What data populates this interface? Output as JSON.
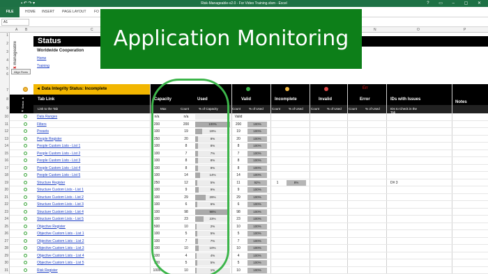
{
  "window": {
    "title": "Risk-Manageable-v2.0 - For Video Training.xlsm - Excel"
  },
  "ribbon": {
    "file": "FILE",
    "tabs": [
      "HOME",
      "INSERT",
      "PAGE LAYOUT",
      "FO"
    ]
  },
  "namebox": "A1",
  "columns": [
    "A",
    "B",
    "C",
    "D",
    "E",
    "F",
    "G",
    "H",
    "I",
    "J",
    "K",
    "L",
    "M",
    "N",
    "O",
    "P"
  ],
  "sheet": {
    "status_title": "Status",
    "company": "Worldwide Cooperation",
    "home_link": "Home",
    "training_link": "Training",
    "align_button": "Align Rows",
    "logo_risk": "risk",
    "logo_manageable": "manageable"
  },
  "banner": {
    "text": "Application Monitoring",
    "color": "#0d7f19"
  },
  "table": {
    "status_heading": "◄ Data Integrity Status: Incomplete",
    "status_side_label": "◄ Status ►",
    "headers": {
      "tab_link": "Tab Link",
      "capacity": "Capacity",
      "used": "Used",
      "valid": "Valid",
      "incomplete": "Incomplete",
      "invalid": "Invalid",
      "error": "Error",
      "ids_with_issues": "IDs with Issues",
      "notes": "Notes",
      "error_flag": "Err"
    },
    "subheaders": {
      "link_to_tab": "Link to the Tab",
      "max": "Max",
      "count": "Count",
      "pct_capacity": "% of Capacity",
      "count_valid": "Count",
      "pct_used_valid": "% of Used",
      "count_incomplete": "Count",
      "pct_used_incomplete": "% of Used",
      "count_invalid": "Count",
      "pct_used_invalid": "% of Used",
      "count_error": "Count",
      "pct_used_error": "% of Used",
      "ids_to_check": "IDs to Check in the Tab"
    },
    "row_numbers": [
      "1",
      "2",
      "3",
      "4",
      "5",
      "6",
      "7",
      "8",
      "9",
      "10",
      "11",
      "12",
      "13",
      "14",
      "15",
      "16",
      "17",
      "18",
      "19",
      "20",
      "21",
      "22",
      "23",
      "24",
      "25",
      "26",
      "27",
      "28",
      "29",
      "30",
      "31"
    ],
    "rows": [
      {
        "name": "Data Ranges",
        "max": "n/a",
        "count": "n/a",
        "pct": "",
        "pct_fill": 0,
        "valid": "Valid",
        "valid_pct": "",
        "incomplete": "",
        "incomplete_pct": "",
        "ids": ""
      },
      {
        "name": "Filters",
        "max": "200",
        "count": "200",
        "pct": "100%",
        "pct_fill": 1.0,
        "valid": "200",
        "valid_pct": "100%",
        "incomplete": "",
        "incomplete_pct": "",
        "ids": ""
      },
      {
        "name": "Presets",
        "max": "100",
        "count": "19",
        "pct": "19%",
        "pct_fill": 0.19,
        "valid": "19",
        "valid_pct": "100%",
        "incomplete": "",
        "incomplete_pct": "",
        "ids": ""
      },
      {
        "name": "People Register",
        "max": "250",
        "count": "20",
        "pct": "8%",
        "pct_fill": 0.08,
        "valid": "20",
        "valid_pct": "100%",
        "incomplete": "",
        "incomplete_pct": "",
        "ids": ""
      },
      {
        "name": "People Custom Lists - List 1",
        "max": "100",
        "count": "8",
        "pct": "8%",
        "pct_fill": 0.08,
        "valid": "8",
        "valid_pct": "100%",
        "incomplete": "",
        "incomplete_pct": "",
        "ids": ""
      },
      {
        "name": "People Custom Lists - List 2",
        "max": "100",
        "count": "7",
        "pct": "7%",
        "pct_fill": 0.07,
        "valid": "7",
        "valid_pct": "100%",
        "incomplete": "",
        "incomplete_pct": "",
        "ids": ""
      },
      {
        "name": "People Custom Lists - List 3",
        "max": "100",
        "count": "8",
        "pct": "8%",
        "pct_fill": 0.08,
        "valid": "8",
        "valid_pct": "100%",
        "incomplete": "",
        "incomplete_pct": "",
        "ids": ""
      },
      {
        "name": "People Custom Lists - List 4",
        "max": "100",
        "count": "8",
        "pct": "8%",
        "pct_fill": 0.08,
        "valid": "8",
        "valid_pct": "100%",
        "incomplete": "",
        "incomplete_pct": "",
        "ids": ""
      },
      {
        "name": "People Custom Lists - List 5",
        "max": "100",
        "count": "14",
        "pct": "14%",
        "pct_fill": 0.14,
        "valid": "14",
        "valid_pct": "100%",
        "incomplete": "",
        "incomplete_pct": "",
        "ids": ""
      },
      {
        "name": "Structure Register",
        "max": "250",
        "count": "12",
        "pct": "5%",
        "pct_fill": 0.05,
        "valid": "11",
        "valid_pct": "92%",
        "incomplete": "1",
        "incomplete_pct": "8%",
        "ids": "D# 3"
      },
      {
        "name": "Structure Custom Lists - List 1",
        "max": "100",
        "count": "9",
        "pct": "9%",
        "pct_fill": 0.09,
        "valid": "9",
        "valid_pct": "100%",
        "incomplete": "",
        "incomplete_pct": "",
        "ids": ""
      },
      {
        "name": "Structure Custom Lists - List 2",
        "max": "100",
        "count": "29",
        "pct": "29%",
        "pct_fill": 0.29,
        "valid": "29",
        "valid_pct": "100%",
        "incomplete": "",
        "incomplete_pct": "",
        "ids": ""
      },
      {
        "name": "Structure Custom Lists - List 3",
        "max": "100",
        "count": "6",
        "pct": "6%",
        "pct_fill": 0.06,
        "valid": "6",
        "valid_pct": "100%",
        "incomplete": "",
        "incomplete_pct": "",
        "ids": ""
      },
      {
        "name": "Structure Custom Lists - List 4",
        "max": "100",
        "count": "98",
        "pct": "98%",
        "pct_fill": 0.98,
        "valid": "98",
        "valid_pct": "100%",
        "incomplete": "",
        "incomplete_pct": "",
        "ids": ""
      },
      {
        "name": "Structure Custom Lists - List 5",
        "max": "100",
        "count": "23",
        "pct": "23%",
        "pct_fill": 0.23,
        "valid": "23",
        "valid_pct": "100%",
        "incomplete": "",
        "incomplete_pct": "",
        "ids": ""
      },
      {
        "name": "Objective Register",
        "max": "500",
        "count": "10",
        "pct": "2%",
        "pct_fill": 0.02,
        "valid": "10",
        "valid_pct": "100%",
        "incomplete": "",
        "incomplete_pct": "",
        "ids": ""
      },
      {
        "name": "Objective Custom Lists - List 1",
        "max": "100",
        "count": "5",
        "pct": "5%",
        "pct_fill": 0.05,
        "valid": "5",
        "valid_pct": "100%",
        "incomplete": "",
        "incomplete_pct": "",
        "ids": ""
      },
      {
        "name": "Objective Custom Lists - List 2",
        "max": "100",
        "count": "7",
        "pct": "7%",
        "pct_fill": 0.07,
        "valid": "7",
        "valid_pct": "100%",
        "incomplete": "",
        "incomplete_pct": "",
        "ids": ""
      },
      {
        "name": "Objective Custom Lists - List 3",
        "max": "100",
        "count": "10",
        "pct": "10%",
        "pct_fill": 0.1,
        "valid": "10",
        "valid_pct": "100%",
        "incomplete": "",
        "incomplete_pct": "",
        "ids": ""
      },
      {
        "name": "Objective Custom Lists - List 4",
        "max": "100",
        "count": "4",
        "pct": "4%",
        "pct_fill": 0.04,
        "valid": "4",
        "valid_pct": "100%",
        "incomplete": "",
        "incomplete_pct": "",
        "ids": ""
      },
      {
        "name": "Objective Custom Lists - List 5",
        "max": "100",
        "count": "5",
        "pct": "5%",
        "pct_fill": 0.05,
        "valid": "5",
        "valid_pct": "100%",
        "incomplete": "",
        "incomplete_pct": "",
        "ids": ""
      },
      {
        "name": "Risk Register",
        "max": "1000",
        "count": "10",
        "pct": "1%",
        "pct_fill": 0.01,
        "valid": "10",
        "valid_pct": "100%",
        "incomplete": "",
        "incomplete_pct": "",
        "ids": ""
      }
    ]
  },
  "colors": {
    "excel_green": "#217346",
    "status_yellow": "#f2b600",
    "valid_dot": "#3cb54a",
    "incomplete_dot": "#f4b942",
    "invalid_dot": "#e04848",
    "error_text": "#e01818",
    "highlight": "#3cb54a"
  },
  "icons": {
    "status_ok": "circle-ok-icon"
  }
}
